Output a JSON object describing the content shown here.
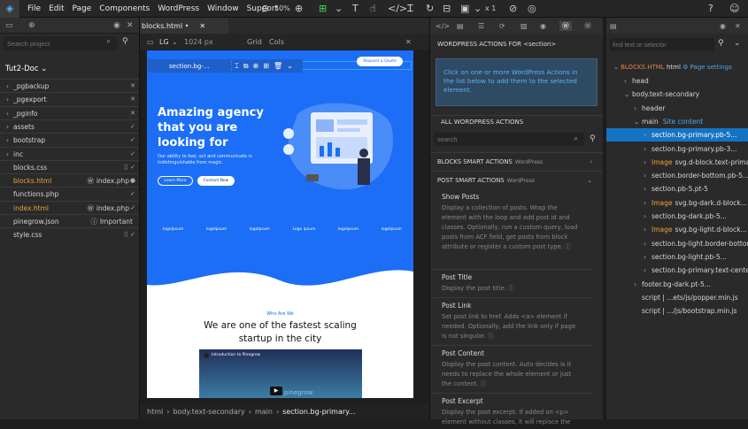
{
  "menubar": {
    "items": [
      "File",
      "Edit",
      "Page",
      "Components",
      "WordPress",
      "Window",
      "Support"
    ],
    "zoom": "50%",
    "multiplier": "x 1"
  },
  "project": {
    "search_placeholder": "Search project",
    "title": "Tut2-Doc",
    "items": [
      {
        "label": "_pgbackup",
        "type": "folder",
        "status": "x"
      },
      {
        "label": "_pgexport",
        "type": "folder",
        "status": "x"
      },
      {
        "label": "_pginfo",
        "type": "folder",
        "status": "x"
      },
      {
        "label": "assets",
        "type": "folder",
        "status": "check"
      },
      {
        "label": "bootstrap",
        "type": "folder",
        "status": "check"
      },
      {
        "label": "inc",
        "type": "folder",
        "status": "check"
      },
      {
        "label": "blocks.css",
        "type": "file",
        "status": "check",
        "extra": ""
      },
      {
        "label": "blocks.html",
        "type": "file",
        "status": "dot",
        "extra": "index.php",
        "active": true
      },
      {
        "label": "functions.php",
        "type": "file",
        "status": "check",
        "extra": ""
      },
      {
        "label": "index.html",
        "type": "file",
        "status": "check",
        "extra": "index.php",
        "active": true
      },
      {
        "label": "pinegrow.json",
        "type": "file",
        "status": "",
        "extra": "Important"
      },
      {
        "label": "style.css",
        "type": "file",
        "status": "check",
        "extra": ""
      }
    ]
  },
  "editor": {
    "tab": "blocks.html •",
    "device": "LG",
    "width": "1024 px",
    "grid": "Grid",
    "cols": "Cols",
    "selected_label": "section.bg-...",
    "breadcrumb": [
      "html",
      "body.text-secondary",
      "main",
      "section.bg-primary..."
    ]
  },
  "site": {
    "cta": "Request a Quote",
    "hero_title": "Amazing agency that you are looking for",
    "hero_text": "Our ability to feel, act and communicate is indistinguishable from magic.",
    "learn_more": "Learn More",
    "contact": "Contact Now",
    "logos": [
      "logolpsum",
      "logolpsum",
      "logolpsum",
      "Logo ipsum",
      "logolpsum",
      "logolpsum"
    ],
    "kicker": "Who Are We",
    "subtitle": "We are one of the fastest scaling startup in the city",
    "video_title": "Introduction to Pinegrow",
    "video_brand": "pinegrow"
  },
  "wp": {
    "header": "WORDPRESS ACTIONS FOR",
    "header_tag": "<section>",
    "info": "Click on one or more WordPress Actions in the list below to add them to the selected element.",
    "all": "ALL WORDPRESS ACTIONS",
    "search_placeholder": "search",
    "groups": [
      {
        "name": "BLOCKS SMART ACTIONS",
        "sub": "WordPress"
      },
      {
        "name": "POST SMART ACTIONS",
        "sub": "WordPress"
      }
    ],
    "actions": [
      {
        "title": "Show Posts",
        "desc": "Display a collection of posts. Wrap the element with the loop and add post id and classes. Optionally, run a custom query, load posts from ACF field, get posts from block attribute or register a custom post type. ⓘ"
      },
      {
        "title": "Post Title",
        "desc": "Display the post title. ⓘ"
      },
      {
        "title": "Post Link",
        "desc": "Set post link to href. Adds <a> element if needed. Optionally, add the link only if page is not singular. ⓘ"
      },
      {
        "title": "Post Content",
        "desc": "Display the post content. Auto decides is it needs to replace the whole element or just the content. ⓘ"
      },
      {
        "title": "Post Excerpt",
        "desc": "Display the post excerpt. If added on <p> element without classes, it will replace the"
      }
    ]
  },
  "tree": {
    "search_placeholder": "find text or selector",
    "file": "BLOCKS.HTML",
    "file_tag": "html",
    "page_settings": "Page settings",
    "rows": [
      {
        "label": "head",
        "indent": 0,
        "arrow": "›"
      },
      {
        "label": "body.text-secondary",
        "indent": 0,
        "arrow": "⌄"
      },
      {
        "label": "header",
        "indent": 1,
        "arrow": "›"
      },
      {
        "label": "main",
        "indent": 1,
        "arrow": "⌄",
        "extra": "Site content"
      },
      {
        "label": "section.bg-primary.pb-5...",
        "indent": 2,
        "arrow": "›",
        "selected": true
      },
      {
        "label": "section.bg-primary.pb-3...",
        "indent": 2,
        "arrow": "›"
      },
      {
        "label": "svg.d-block.text-primary",
        "indent": 2,
        "arrow": "›",
        "prefix": "Image"
      },
      {
        "label": "section.border-bottom.pb-5...",
        "indent": 2,
        "arrow": "›"
      },
      {
        "label": "section.pb-5.pt-5",
        "indent": 2,
        "arrow": "›"
      },
      {
        "label": "svg.bg-dark.d-block...",
        "indent": 2,
        "arrow": "›",
        "prefix": "Image"
      },
      {
        "label": "section.bg-dark.pb-5...",
        "indent": 2,
        "arrow": "›"
      },
      {
        "label": "svg.bg-light.d-block...",
        "indent": 2,
        "arrow": "›",
        "prefix": "Image"
      },
      {
        "label": "section.bg-light.border-bottom...",
        "indent": 2,
        "arrow": "›"
      },
      {
        "label": "section.bg-light.pb-5...",
        "indent": 2,
        "arrow": "›"
      },
      {
        "label": "section.bg-primary.text-center...",
        "indent": 2,
        "arrow": "›"
      },
      {
        "label": "footer.bg-dark.pt-5...",
        "indent": 1,
        "arrow": "›"
      },
      {
        "label": "script | ...ets/js/popper.min.js",
        "indent": 1,
        "arrow": ""
      },
      {
        "label": "script | .../js/bootstrap.min.js",
        "indent": 1,
        "arrow": ""
      }
    ]
  }
}
